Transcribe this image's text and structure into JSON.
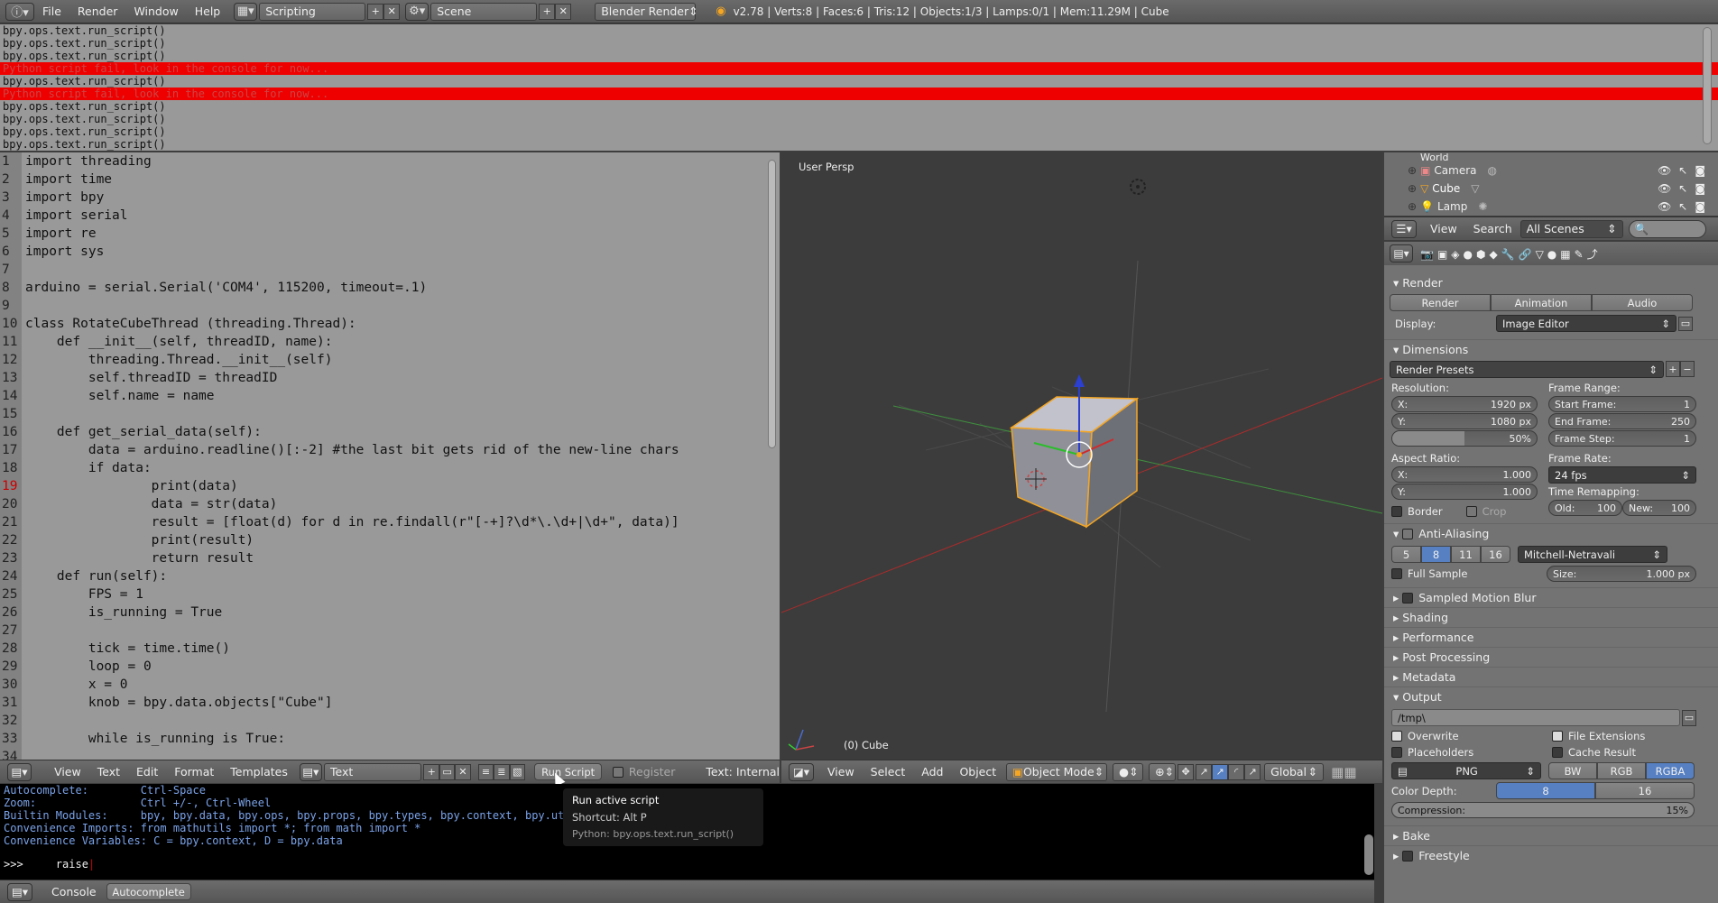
{
  "topbar": {
    "menus": [
      "File",
      "Render",
      "Window",
      "Help"
    ],
    "layout": "Scripting",
    "scene": "Scene",
    "engine": "Blender Render",
    "stats": "v2.78 | Verts:8 | Faces:6 | Tris:12 | Objects:1/3 | Lamps:0/1 | Mem:11.29M | Cube"
  },
  "info_log": [
    {
      "text": "bpy.ops.text.run_script()",
      "error": false
    },
    {
      "text": "bpy.ops.text.run_script()",
      "error": false
    },
    {
      "text": "bpy.ops.text.run_script()",
      "error": false
    },
    {
      "text": "Python script fail, look in the console for now...",
      "error": true
    },
    {
      "text": "bpy.ops.text.run_script()",
      "error": false
    },
    {
      "text": "Python script fail, look in the console for now...",
      "error": true
    },
    {
      "text": "bpy.ops.text.run_script()",
      "error": false
    },
    {
      "text": "bpy.ops.text.run_script()",
      "error": false
    },
    {
      "text": "bpy.ops.text.run_script()",
      "error": false
    },
    {
      "text": "bpy.ops.text.run_script()",
      "error": false
    }
  ],
  "text_editor": {
    "current_line": 19,
    "lines": [
      "import threading",
      "import time",
      "import bpy",
      "import serial",
      "import re",
      "import sys",
      "",
      "arduino = serial.Serial('COM4', 115200, timeout=.1)",
      "",
      "class RotateCubeThread (threading.Thread):",
      "    def __init__(self, threadID, name):",
      "        threading.Thread.__init__(self)",
      "        self.threadID = threadID",
      "        self.name = name",
      "",
      "    def get_serial_data(self):",
      "        data = arduino.readline()[:-2] #the last bit gets rid of the new-line chars",
      "        if data:",
      "                print(data)",
      "                data = str(data)",
      "                result = [float(d) for d in re.findall(r\"[-+]?\\d*\\.\\d+|\\d+\", data)]",
      "                print(result)",
      "                return result",
      "    def run(self):",
      "        FPS = 1",
      "        is_running = True",
      "",
      "        tick = time.time()",
      "        loop = 0",
      "        x = 0",
      "        knob = bpy.data.objects[\"Cube\"]",
      "",
      "        while is_running is True:",
      ""
    ],
    "line_numbers": [
      "1",
      "2",
      "3",
      "4",
      "5",
      "6",
      "7",
      "8",
      "9",
      "10",
      "11",
      "12",
      "13",
      "14",
      "15",
      "16",
      "17",
      "18",
      "19",
      "20",
      "21",
      "22",
      "23",
      "24",
      "25",
      "26",
      "27",
      "28",
      "29",
      "30",
      "31",
      "32",
      "33",
      "34"
    ],
    "header": {
      "menus": [
        "View",
        "Text",
        "Edit",
        "Format",
        "Templates"
      ],
      "text_name": "Text",
      "run_script": "Run Script",
      "register": "Register",
      "status": "Text: Internal"
    }
  },
  "viewport": {
    "label": "User Persp",
    "object_label": "(0) Cube",
    "header": {
      "menus": [
        "View",
        "Select",
        "Add",
        "Object"
      ],
      "mode": "Object Mode",
      "orientation": "Global"
    }
  },
  "outliner": {
    "items": [
      "World",
      "Camera",
      "Cube",
      "Lamp"
    ],
    "header": {
      "view": "View",
      "search": "Search",
      "filter": "All Scenes"
    }
  },
  "properties": {
    "render": {
      "title": "Render",
      "buttons": [
        "Render",
        "Animation",
        "Audio"
      ],
      "display_label": "Display:",
      "display_value": "Image Editor"
    },
    "dimensions": {
      "title": "Dimensions",
      "presets": "Render Presets",
      "resolution_label": "Resolution:",
      "res_x_label": "X:",
      "res_x": "1920 px",
      "res_y_label": "Y:",
      "res_y": "1080 px",
      "res_pct": "50%",
      "res_pct_value": 0.5,
      "frame_range_label": "Frame Range:",
      "start_label": "Start Frame:",
      "start": "1",
      "end_label": "End Frame:",
      "end": "250",
      "step_label": "Frame Step:",
      "step": "1",
      "aspect_label": "Aspect Ratio:",
      "asp_x_label": "X:",
      "asp_x": "1.000",
      "asp_y_label": "Y:",
      "asp_y": "1.000",
      "frame_rate_label": "Frame Rate:",
      "frame_rate": "24 fps",
      "border": "Border",
      "crop": "Crop",
      "time_remap_label": "Time Remapping:",
      "old_label": "Old:",
      "old": "100",
      "new_label": "New:",
      "new": "100"
    },
    "anti_aliasing": {
      "title": "Anti-Aliasing",
      "samples": [
        "5",
        "8",
        "11",
        "16"
      ],
      "selected_sample": "8",
      "filter": "Mitchell-Netravali",
      "full_sample": "Full Sample",
      "size_label": "Size:",
      "size": "1.000 px"
    },
    "collapsed_panels": [
      "Sampled Motion Blur",
      "Shading",
      "Performance",
      "Post Processing",
      "Metadata"
    ],
    "output": {
      "title": "Output",
      "path": "/tmp\\",
      "overwrite": "Overwrite",
      "file_extensions": "File Extensions",
      "placeholders": "Placeholders",
      "cache_result": "Cache Result",
      "format": "PNG",
      "color_modes": [
        "BW",
        "RGB",
        "RGBA"
      ],
      "color_mode_selected": "RGBA",
      "color_depth_label": "Color Depth:",
      "depths": [
        "8",
        "16"
      ],
      "depth_selected": "8",
      "compression_label": "Compression:",
      "compression": "15%"
    },
    "bottom_panels": [
      "Bake",
      "Freestyle"
    ]
  },
  "console": {
    "lines": [
      "Autocomplete:        Ctrl-Space",
      "Zoom:                Ctrl +/-, Ctrl-Wheel",
      "Builtin Modules:     bpy, bpy.data, bpy.ops, bpy.props, bpy.types, bpy.context, bpy.utils, bgl, blf, mathutils",
      "Convenience Imports: from mathutils import *; from math import *",
      "Convenience Variables: C = bpy.context, D = bpy.data"
    ],
    "prompt": ">>>",
    "input": "     raise",
    "header": {
      "console": "Console",
      "autocomplete": "Autocomplete"
    }
  },
  "tooltip": {
    "title": "Run active script",
    "shortcut": "Shortcut: Alt P",
    "python": "Python: bpy.ops.text.run_script()"
  },
  "colors": {
    "accent": "#5680c2",
    "error": "#e00000",
    "selected_object": "#f5a623"
  }
}
